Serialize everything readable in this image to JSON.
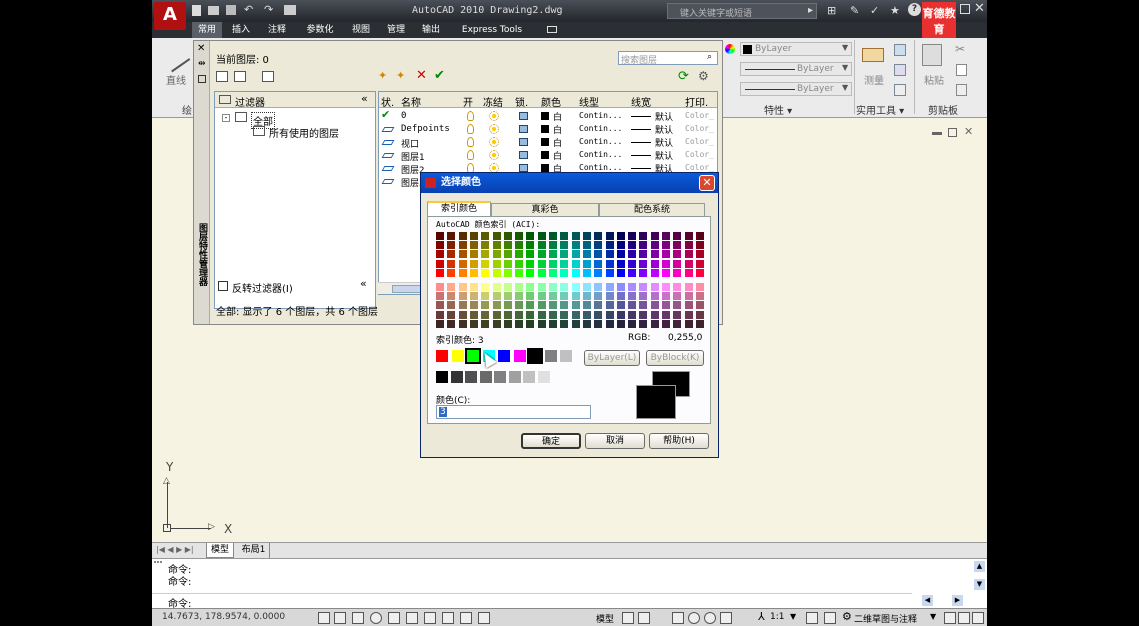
{
  "app": {
    "title": "AutoCAD 2010   Drawing2.dwg",
    "search_placeholder": "键入关键字或短语"
  },
  "quick_access": [
    "new-icon",
    "open-icon",
    "save-icon",
    "undo-icon",
    "redo-icon",
    "print-icon"
  ],
  "tabs": [
    "常用",
    "插入",
    "注释",
    "参数化",
    "视图",
    "管理",
    "输出",
    "Express Tools"
  ],
  "ribbon": {
    "left_group_label": "绘",
    "left_tool": "直线",
    "properties": {
      "label": "特性 ▾",
      "color": "ByLayer",
      "linetype": "ByLayer",
      "lineweight": "ByLayer"
    },
    "utilities": {
      "label": "实用工具 ▾",
      "measure": "测量"
    },
    "clipboard": {
      "label": "剪贴板",
      "paste": "粘贴"
    }
  },
  "watermark": "育德教育",
  "layer_manager": {
    "current_layer_label": "当前图层: 0",
    "search_placeholder": "搜索图层",
    "filter_header": "过滤器",
    "tree": {
      "all": "全部",
      "used": "所有使用的图层"
    },
    "invert_filter": "反转过滤器(I)",
    "vertical_title": "图层特性管理器",
    "columns": [
      "状.",
      "名称",
      "开",
      "冻结",
      "锁.",
      "颜色",
      "线型",
      "线宽",
      "打印."
    ],
    "rows": [
      {
        "name": "0",
        "color": "白",
        "linetype": "Contin...",
        "lineweight": "默认",
        "plot": "Color_"
      },
      {
        "name": "Defpoints",
        "color": "白",
        "linetype": "Contin...",
        "lineweight": "默认",
        "plot": "Color_"
      },
      {
        "name": "视口",
        "color": "白",
        "linetype": "Contin...",
        "lineweight": "默认",
        "plot": "Color_"
      },
      {
        "name": "图层1",
        "color": "白",
        "linetype": "Contin...",
        "lineweight": "默认",
        "plot": "Color_"
      },
      {
        "name": "图层2",
        "color": "白",
        "linetype": "Contin...",
        "lineweight": "默认",
        "plot": "Color_"
      },
      {
        "name": "图层3",
        "color": "",
        "linetype": "",
        "lineweight": "",
        "plot": ""
      }
    ],
    "status": "全部: 显示了 6 个图层，共 6 个图层"
  },
  "color_dialog": {
    "title": "选择颜色",
    "tabs": [
      "索引颜色",
      "真彩色",
      "配色系统"
    ],
    "aci_label": "AutoCAD 颜色索引 (ACI):",
    "index_label": "索引颜色: 3",
    "rgb_label": "RGB:",
    "rgb_value": "0,255,0",
    "bylayer": "ByLayer(L)",
    "byblock": "ByBlock(K)",
    "color_label": "颜色(C):",
    "color_value": "3",
    "ok": "确定",
    "cancel": "取消",
    "help": "帮助(H)",
    "standard_colors": [
      "#ff0000",
      "#ffff00",
      "#00ff00",
      "#00ffff",
      "#0000ff",
      "#ff00ff",
      "#000000",
      "#808080",
      "#c0c0c0"
    ],
    "gray_colors": [
      "#000000",
      "#333333",
      "#505050",
      "#696969",
      "#808080",
      "#a0a0a0",
      "#c0c0c0",
      "#e0e0e0"
    ],
    "preview_color": "#000000"
  },
  "drawing": {
    "ucs_x": "X",
    "ucs_y": "Y",
    "tabs": [
      "模型",
      "布局1"
    ]
  },
  "command": {
    "lines": [
      "命令:",
      "命令:"
    ],
    "prompt": "命令:"
  },
  "status_bar": {
    "coords": "14.7673, 178.9574, 0.0000",
    "model": "模型",
    "scale": "1:1",
    "workspace": "二维草图与注释"
  }
}
